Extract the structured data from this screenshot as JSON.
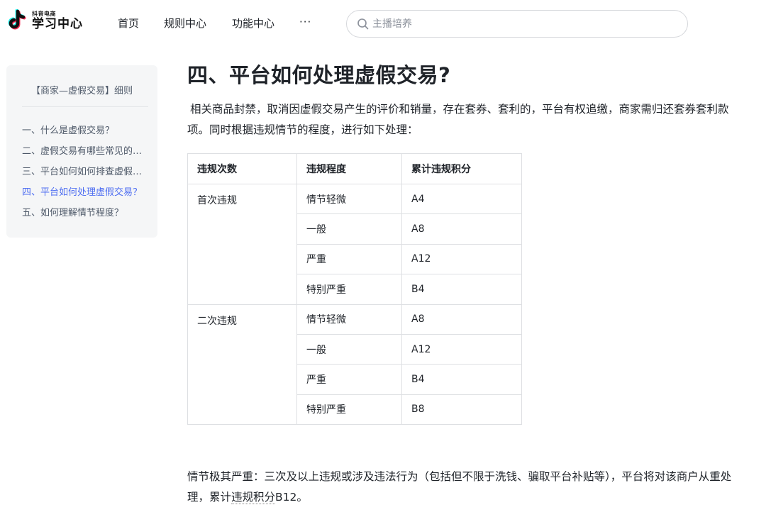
{
  "header": {
    "logo_sub": "抖音电商",
    "logo_main": "学习中心",
    "nav": [
      {
        "label": "首页"
      },
      {
        "label": "规则中心"
      },
      {
        "label": "功能中心"
      },
      {
        "label": "···"
      }
    ],
    "search": {
      "placeholder": "主播培养",
      "icon": "search-icon"
    }
  },
  "toc": {
    "title": "【商家—虚假交易】细则",
    "items": [
      {
        "label": "一、什么是虚假交易？",
        "active": false
      },
      {
        "label": "二、虚假交易有哪些常见的形式？",
        "active": false
      },
      {
        "label": "三、平台如何如何排查虚假交易？",
        "active": false
      },
      {
        "label": "四、平台如何处理虚假交易？",
        "active": true
      },
      {
        "label": "五、如何理解情节程度？",
        "active": false
      }
    ],
    "active_color": "#4e6ef2"
  },
  "article": {
    "heading": "四、平台如何处理虚假交易?",
    "paragraph1": "相关商品封禁，取消因虚假交易产生的评价和销量，存在套券、套利的，平台有权追缴，商家需归还套券套利款项。同时根据违规情节的程度，进行如下处理：",
    "table": {
      "headers": [
        "违规次数",
        "违规程度",
        "累计违规积分"
      ],
      "groups": [
        {
          "count": "首次违规",
          "rows": [
            {
              "level": "情节轻微",
              "points": "A4"
            },
            {
              "level": "一般",
              "points": "A8"
            },
            {
              "level": "严重",
              "points": "A12"
            },
            {
              "level": "特别严重",
              "points": "B4"
            }
          ]
        },
        {
          "count": "二次违规",
          "rows": [
            {
              "level": "情节轻微",
              "points": "A8"
            },
            {
              "level": "一般",
              "points": "A12"
            },
            {
              "level": "严重",
              "points": "B4"
            },
            {
              "level": "特别严重",
              "points": "B8"
            }
          ]
        }
      ]
    },
    "paragraph2_a": "情节极其严重：三次及以上违规或涉及违法行为（包括但不限于洗钱、骗取平台补贴等），平台将对该商户从重处理，累计",
    "paragraph2_b": "违规积分",
    "paragraph2_c": "B12。"
  }
}
